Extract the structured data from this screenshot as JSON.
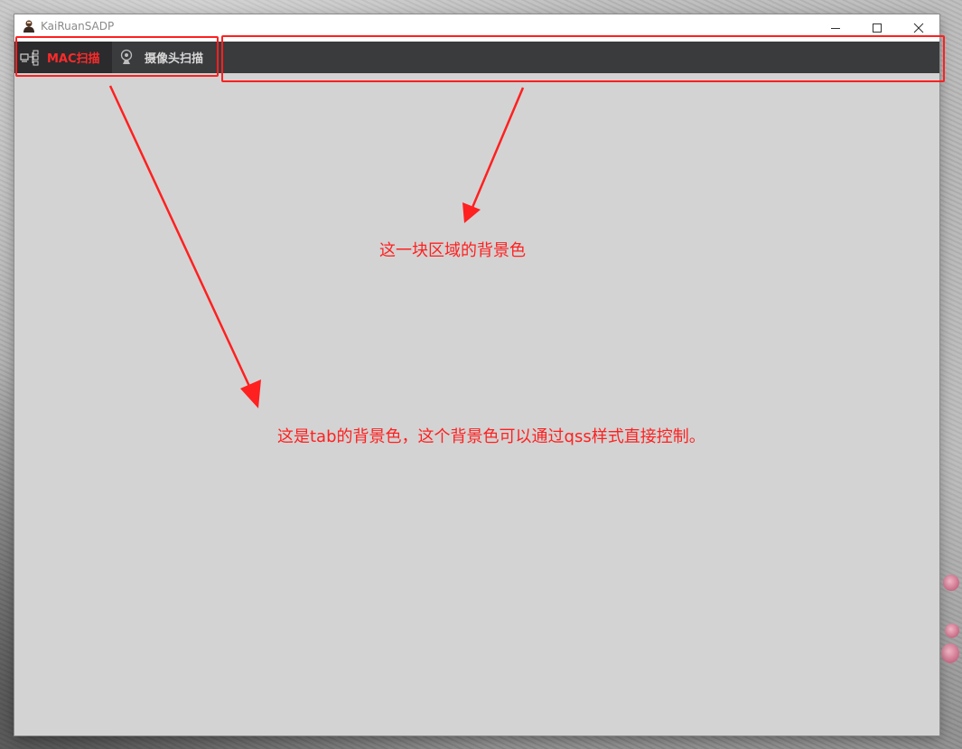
{
  "window": {
    "title": "KaiRuanSADP"
  },
  "titlebar_buttons": {
    "minimize_icon": "minimize-icon",
    "maximize_icon": "maximize-icon",
    "close_icon": "close-icon"
  },
  "tabs": [
    {
      "label": "MAC扫描",
      "icon": "network-scan-icon",
      "selected": true,
      "color": "#ff2a2a"
    },
    {
      "label": "摄像头扫描",
      "icon": "camera-icon",
      "selected": false,
      "color": "#d8d8d8"
    }
  ],
  "colors": {
    "tab_bar_bg": "#3a3b3d",
    "selected_tab_bg": "#2b2b2d",
    "content_bg": "#d3d3d3",
    "annotation": "#ff2020"
  },
  "annotations": {
    "area_note": "这一块区域的背景色",
    "tab_note": "这是tab的背景色，这个背景色可以通过qss样式直接控制。"
  }
}
